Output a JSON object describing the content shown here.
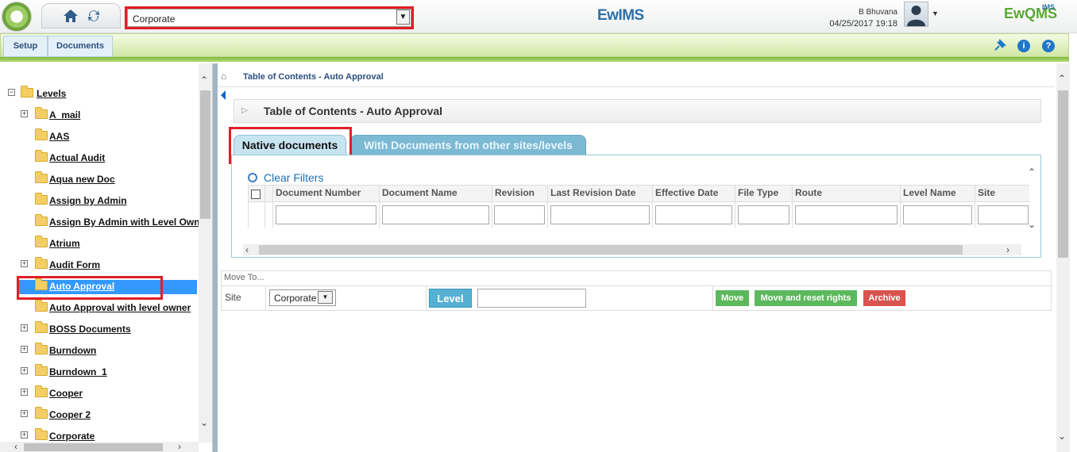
{
  "header": {
    "site_select_value": "Corporate",
    "brand_left": "EwIMS",
    "user_name": "B Bhuvana",
    "datetime": "04/25/2017 19:18",
    "brand_right": "EwQMS",
    "brand_right_sup": "IMS"
  },
  "menubar": {
    "setup_label": "Setup",
    "documents_label": "Documents"
  },
  "tree": {
    "root": "Levels",
    "items": [
      {
        "label": "A_mail",
        "expandable": true
      },
      {
        "label": "AAS",
        "expandable": false
      },
      {
        "label": "Actual Audit",
        "expandable": false
      },
      {
        "label": "Aqua new Doc",
        "expandable": false
      },
      {
        "label": "Assign by Admin",
        "expandable": false
      },
      {
        "label": "Assign By Admin with Level Owner",
        "expandable": false
      },
      {
        "label": "Atrium",
        "expandable": false
      },
      {
        "label": "Audit Form",
        "expandable": true
      },
      {
        "label": "Auto Approval",
        "expandable": false,
        "selected": true
      },
      {
        "label": "Auto Approval with level owner",
        "expandable": false
      },
      {
        "label": "BOSS Documents",
        "expandable": true
      },
      {
        "label": "Burndown",
        "expandable": true
      },
      {
        "label": "Burndown_1",
        "expandable": true
      },
      {
        "label": "Cooper",
        "expandable": true
      },
      {
        "label": "Cooper 2",
        "expandable": true
      },
      {
        "label": "Corporate",
        "expandable": true
      }
    ]
  },
  "breadcrumb": "Table of Contents - Auto Approval",
  "toc_title": "Table of Contents - Auto Approval",
  "tabs": {
    "native": "Native documents",
    "other": "With Documents from other sites/levels"
  },
  "grid": {
    "clear_filters": "Clear Filters",
    "columns": [
      "Document Number",
      "Document Name",
      "Revision",
      "Last Revision Date",
      "Effective Date",
      "File Type",
      "Route",
      "Level Name",
      "Site"
    ]
  },
  "move": {
    "title": "Move To...",
    "site_label": "Site",
    "site_value": "Corporate",
    "level_button": "Level",
    "move_button": "Move",
    "move_reset_button": "Move and reset rights",
    "archive_button": "Archive"
  },
  "colors": {
    "accent_green": "#5cb85c",
    "archive_red": "#d9534f",
    "selection_blue": "#3399ff",
    "highlight_red": "#e21e26"
  }
}
